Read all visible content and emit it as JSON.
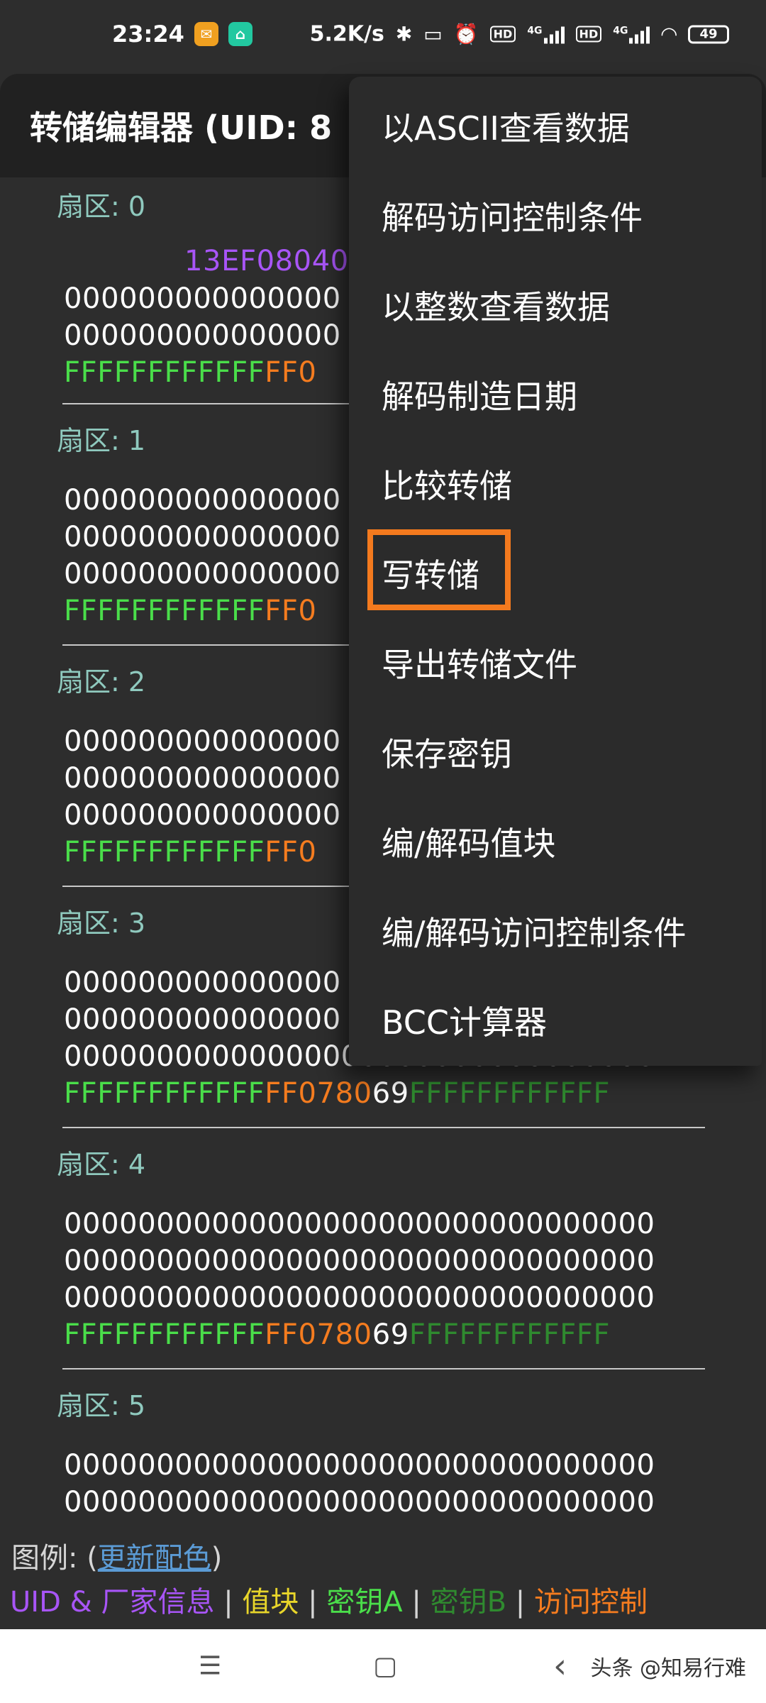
{
  "status_bar": {
    "time": "23:24",
    "speed": "5.2K/s",
    "battery": "49",
    "net1": "4G",
    "net2": "4G",
    "hd1": "HD",
    "hd2": "HD",
    "icons": [
      "mail-icon",
      "mi-home-icon",
      "bluetooth-icon",
      "vibrate-icon",
      "alarm-icon",
      "hd-icon",
      "signal-icon",
      "wifi-icon",
      "battery-icon"
    ]
  },
  "app_bar": {
    "title": "转储编辑器 (UID: 8"
  },
  "sectors": [
    {
      "title": "扇区: 0",
      "uid_line": "13EF08040",
      "lines": [
        "000000000000000",
        "000000000000000"
      ],
      "trailer": {
        "keya": "FFFFFFFFFFFF",
        "ac": "FF0"
      }
    },
    {
      "title": "扇区: 1",
      "lines": [
        "000000000000000",
        "000000000000000",
        "000000000000000"
      ],
      "trailer": {
        "keya": "FFFFFFFFFFFF",
        "ac": "FF0"
      }
    },
    {
      "title": "扇区: 2",
      "lines": [
        "000000000000000",
        "000000000000000",
        "000000000000000"
      ],
      "trailer": {
        "keya": "FFFFFFFFFFFF",
        "ac": "FF0"
      }
    },
    {
      "title": "扇区: 3",
      "lines": [
        "000000000000000",
        "000000000000000",
        "00000000000000000000000000000000"
      ],
      "trailer": {
        "keya": "FFFFFFFFFFFF",
        "ac": "FF0780",
        "gpb": "69",
        "keyb": "FFFFFFFFFFFF"
      }
    },
    {
      "title": "扇区: 4",
      "lines": [
        "00000000000000000000000000000000",
        "00000000000000000000000000000000",
        "00000000000000000000000000000000"
      ],
      "trailer": {
        "keya": "FFFFFFFFFFFF",
        "ac": "FF0780",
        "gpb": "69",
        "keyb": "FFFFFFFFFFFF"
      }
    },
    {
      "title": "扇区: 5",
      "lines": [
        "00000000000000000000000000000000",
        "00000000000000000000000000000000"
      ]
    }
  ],
  "legend": {
    "label": "图例: (",
    "link": "更新配色",
    "close": ")",
    "uid": "UID & 厂家信息",
    "sep": " | ",
    "value": "值块",
    "keya": "密钥A",
    "keyb": "密钥B",
    "ac": "访问控制"
  },
  "menu": {
    "items": [
      "以ASCII查看数据",
      "解码访问控制条件",
      "以整数查看数据",
      "解码制造日期",
      "比较转储",
      "写转储",
      "导出转储文件",
      "保存密钥",
      "编/解码值块",
      "编/解码访问控制条件",
      "BCC计算器"
    ],
    "highlighted_item": "写转储"
  },
  "nav_bar": {
    "menu_glyph": "☰",
    "home_glyph": "▢",
    "back_glyph": "‹",
    "watermark": "头条 @知易行难"
  },
  "colors": {
    "uid": "#a855f7",
    "value": "#e8d52a",
    "keya": "#4ade4a",
    "keyb": "#2f8a2f",
    "access": "#f57c1f",
    "highlight": "#f47a1e"
  }
}
